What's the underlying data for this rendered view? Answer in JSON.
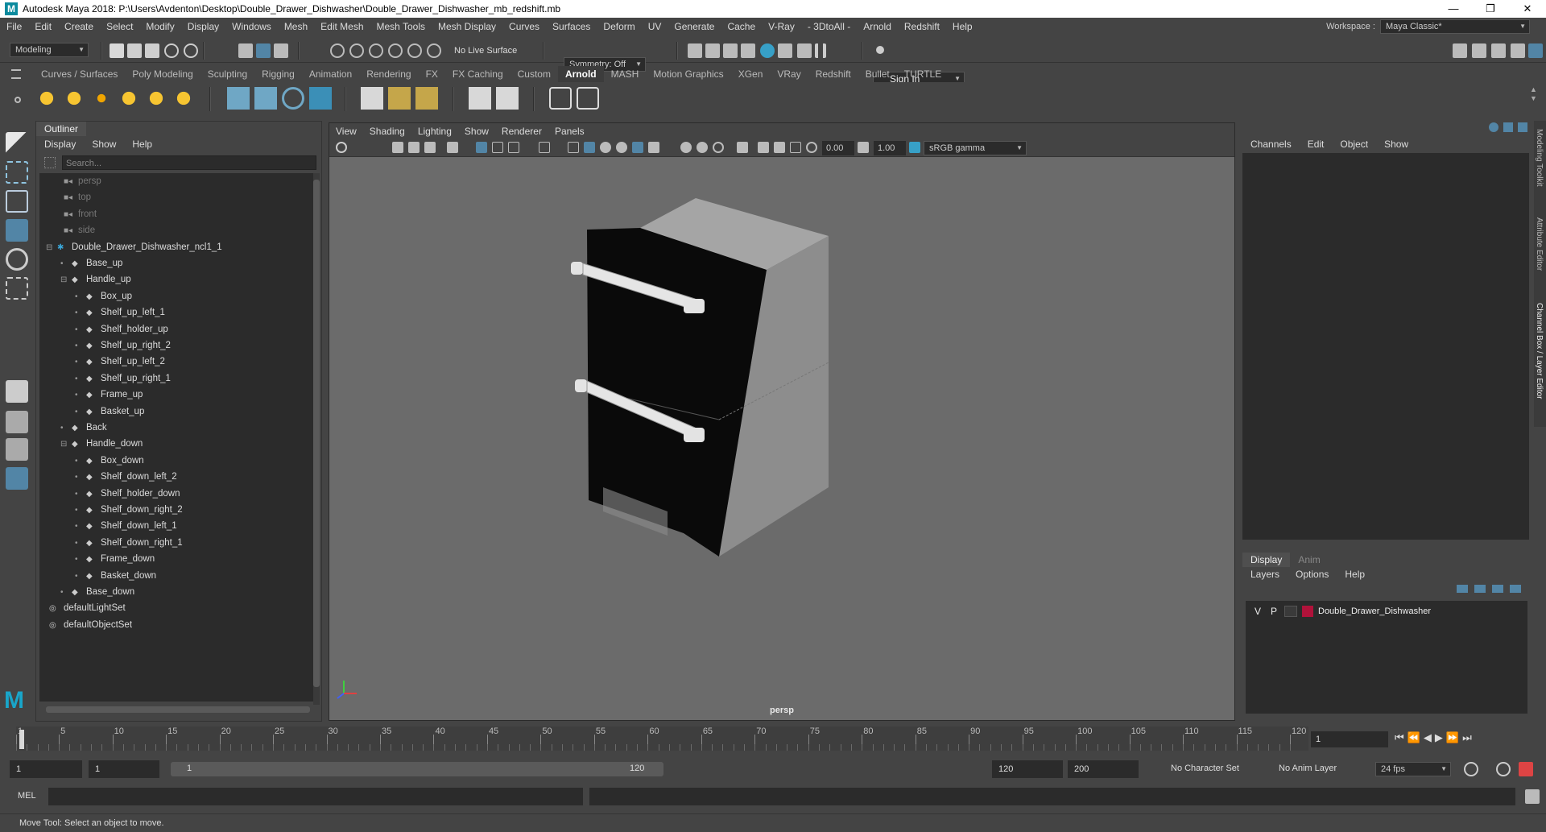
{
  "window": {
    "title": "Autodesk Maya 2018: P:\\Users\\Avdenton\\Desktop\\Double_Drawer_Dishwasher\\Double_Drawer_Dishwasher_mb_redshift.mb",
    "controls": [
      "—",
      "❐",
      "✕"
    ]
  },
  "menus": [
    "File",
    "Edit",
    "Create",
    "Select",
    "Modify",
    "Display",
    "Windows",
    "Mesh",
    "Edit Mesh",
    "Mesh Tools",
    "Mesh Display",
    "Curves",
    "Surfaces",
    "Deform",
    "UV",
    "Generate",
    "Cache",
    "V-Ray",
    "- 3DtoAll -",
    "Arnold",
    "Redshift",
    "Help"
  ],
  "workspace": {
    "label": "Workspace :",
    "value": "Maya Classic*"
  },
  "statusline": {
    "menu_set": "Modeling",
    "live_surface": "No Live Surface",
    "symmetry": "Symmetry: Off",
    "sign_in": "Sign In"
  },
  "shelf_tabs": [
    "Curves / Surfaces",
    "Poly Modeling",
    "Sculpting",
    "Rigging",
    "Animation",
    "Rendering",
    "FX",
    "FX Caching",
    "Custom",
    "Arnold",
    "MASH",
    "Motion Graphics",
    "XGen",
    "VRay",
    "Redshift",
    "Bullet",
    "TURTLE"
  ],
  "shelf_active": "Arnold",
  "outliner": {
    "title": "Outliner",
    "menu": [
      "Display",
      "Show",
      "Help"
    ],
    "search_placeholder": "Search...",
    "items": [
      {
        "label": "persp",
        "depth": 0,
        "icon": "camera-icon",
        "kind": "cam"
      },
      {
        "label": "top",
        "depth": 0,
        "icon": "camera-icon",
        "kind": "cam"
      },
      {
        "label": "front",
        "depth": 0,
        "icon": "camera-icon",
        "kind": "cam"
      },
      {
        "label": "side",
        "depth": 0,
        "icon": "camera-icon",
        "kind": "cam"
      },
      {
        "label": "Double_Drawer_Dishwasher_ncl1_1",
        "depth": 0,
        "icon": "group-icon",
        "exp": "-"
      },
      {
        "label": "Base_up",
        "depth": 1,
        "icon": "mesh-icon",
        "exp": "+"
      },
      {
        "label": "Handle_up",
        "depth": 1,
        "icon": "mesh-icon",
        "exp": "-"
      },
      {
        "label": "Box_up",
        "depth": 2,
        "icon": "mesh-icon",
        "exp": "+"
      },
      {
        "label": "Shelf_up_left_1",
        "depth": 2,
        "icon": "mesh-icon",
        "exp": "+"
      },
      {
        "label": "Shelf_holder_up",
        "depth": 2,
        "icon": "mesh-icon",
        "exp": "+"
      },
      {
        "label": "Shelf_up_right_2",
        "depth": 2,
        "icon": "mesh-icon",
        "exp": "+"
      },
      {
        "label": "Shelf_up_left_2",
        "depth": 2,
        "icon": "mesh-icon",
        "exp": "+"
      },
      {
        "label": "Shelf_up_right_1",
        "depth": 2,
        "icon": "mesh-icon",
        "exp": "+"
      },
      {
        "label": "Frame_up",
        "depth": 2,
        "icon": "mesh-icon",
        "exp": "+"
      },
      {
        "label": "Basket_up",
        "depth": 2,
        "icon": "mesh-icon",
        "exp": "+"
      },
      {
        "label": "Back",
        "depth": 1,
        "icon": "mesh-icon",
        "exp": "+"
      },
      {
        "label": "Handle_down",
        "depth": 1,
        "icon": "mesh-icon",
        "exp": "-"
      },
      {
        "label": "Box_down",
        "depth": 2,
        "icon": "mesh-icon",
        "exp": "+"
      },
      {
        "label": "Shelf_down_left_2",
        "depth": 2,
        "icon": "mesh-icon",
        "exp": "+"
      },
      {
        "label": "Shelf_holder_down",
        "depth": 2,
        "icon": "mesh-icon",
        "exp": "+"
      },
      {
        "label": "Shelf_down_right_2",
        "depth": 2,
        "icon": "mesh-icon",
        "exp": "+"
      },
      {
        "label": "Shelf_down_left_1",
        "depth": 2,
        "icon": "mesh-icon",
        "exp": "+"
      },
      {
        "label": "Shelf_down_right_1",
        "depth": 2,
        "icon": "mesh-icon",
        "exp": "+"
      },
      {
        "label": "Frame_down",
        "depth": 2,
        "icon": "mesh-icon",
        "exp": "+"
      },
      {
        "label": "Basket_down",
        "depth": 2,
        "icon": "mesh-icon",
        "exp": "+"
      },
      {
        "label": "Base_down",
        "depth": 1,
        "icon": "mesh-icon",
        "exp": "+"
      },
      {
        "label": "defaultLightSet",
        "depth": 0,
        "icon": "set-icon"
      },
      {
        "label": "defaultObjectSet",
        "depth": 0,
        "icon": "set-icon"
      }
    ]
  },
  "viewport": {
    "menu": [
      "View",
      "Shading",
      "Lighting",
      "Show",
      "Renderer",
      "Panels"
    ],
    "exposure": "0.00",
    "gamma": "1.00",
    "color_space": "sRGB gamma",
    "camera_label": "persp"
  },
  "channel_box": {
    "menu": [
      "Channels",
      "Edit",
      "Object",
      "Show"
    ]
  },
  "layer_editor": {
    "tabs": [
      "Display",
      "Anim"
    ],
    "menu": [
      "Layers",
      "Options",
      "Help"
    ],
    "layers": [
      {
        "v": "V",
        "p": "P",
        "name": "Double_Drawer_Dishwasher",
        "color": "#b0123a"
      }
    ]
  },
  "side_tabs": [
    "Modeling Toolkit",
    "Attribute Editor",
    "Channel Box / Layer Editor"
  ],
  "timeline": {
    "ticks": [
      "1",
      "5",
      "10",
      "15",
      "20",
      "25",
      "30",
      "35",
      "40",
      "45",
      "50",
      "55",
      "60",
      "65",
      "70",
      "75",
      "80",
      "85",
      "90",
      "95",
      "100",
      "105",
      "110",
      "115",
      "120"
    ],
    "current_frame": "1"
  },
  "range": {
    "start": "1",
    "anim_start": "1",
    "slider_start": "1",
    "slider_end": "120",
    "anim_end": "120",
    "end": "200",
    "character_set": "No Character Set",
    "anim_layer": "No Anim Layer",
    "fps": "24 fps"
  },
  "command": {
    "label": "MEL"
  },
  "help_line": "Move Tool: Select an object to move."
}
